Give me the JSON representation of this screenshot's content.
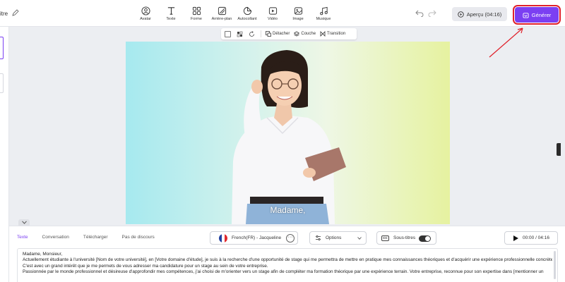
{
  "header": {
    "title": "itre",
    "tools": [
      {
        "label": "Avatar",
        "icon": "avatar-icon"
      },
      {
        "label": "Texte",
        "icon": "text-icon"
      },
      {
        "label": "Forme",
        "icon": "shapes-icon"
      },
      {
        "label": "Arrière-plan",
        "icon": "background-icon"
      },
      {
        "label": "Autocollant",
        "icon": "sticker-icon"
      },
      {
        "label": "Vidéo",
        "icon": "video-icon"
      },
      {
        "label": "Image",
        "icon": "image-icon"
      },
      {
        "label": "Musique",
        "icon": "music-icon"
      }
    ],
    "preview_label": "Aperçu (04:16)",
    "generate_label": "Générer",
    "accent_color": "#7b3ff2",
    "highlight_color": "#e0202a"
  },
  "canvas_toolbar": {
    "detach_label": "Détacher",
    "layer_label": "Couche",
    "transition_label": "Transition"
  },
  "canvas": {
    "subtitle": "Madame,"
  },
  "panel": {
    "tabs": [
      "Texte",
      "Conversation",
      "Télécharger",
      "Pas de discours"
    ],
    "active_tab": "Texte",
    "voice": "French(FR) - Jacqueline",
    "voice_more": "···",
    "options_label": "Options",
    "subtitles_label": "Sous-titres",
    "subtitles_on": true,
    "cc_label": "CC",
    "time": "00:00 / 04:16",
    "script_lines": [
      "Madame, Monsieur,",
      "Actuellement étudiante à l'université [Nom de votre université], en [Votre domaine d'étude], je suis à la recherche d'une opportunité de stage qui me permettra de mettre en pratique mes connaissances théoriques et d'acquérir une expérience professionnelle concrète.",
      "C'est avec un grand intérêt que je me permets de vous adresser ma candidature pour un stage au sein de votre entreprise.",
      "Passionnée par le monde professionnel et désireuse d'approfondir mes compétences, j'ai choisi de m'orienter vers un stage afin de compléter ma formation théorique par une expérience terrain. Votre entreprise, reconnue pour son expertise dans [mentionner un"
    ]
  }
}
